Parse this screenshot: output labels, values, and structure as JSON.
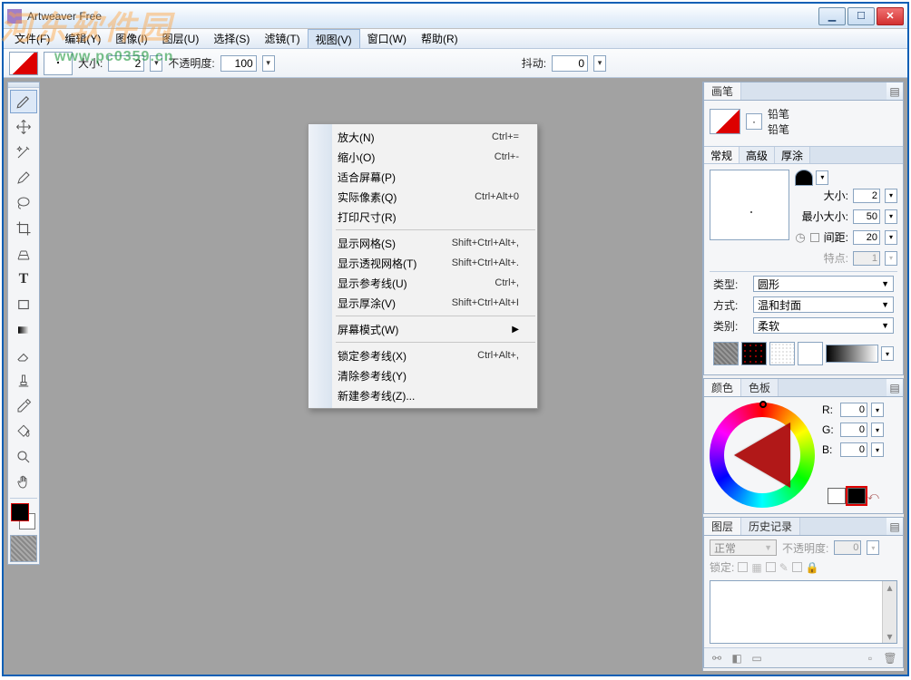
{
  "app": {
    "title": "Artweaver Free"
  },
  "watermark": {
    "text": "河东软件园",
    "url": "www.pc0359.cn"
  },
  "window_controls": {
    "min": "▁",
    "max": "☐",
    "close": "✕"
  },
  "menubar": [
    {
      "key": "file",
      "label": "文件(F)"
    },
    {
      "key": "edit",
      "label": "编辑(Y)"
    },
    {
      "key": "image",
      "label": "图像(I)"
    },
    {
      "key": "layer",
      "label": "图层(U)"
    },
    {
      "key": "select",
      "label": "选择(S)"
    },
    {
      "key": "filter",
      "label": "滤镜(T)"
    },
    {
      "key": "view",
      "label": "视图(V)",
      "open": true
    },
    {
      "key": "window",
      "label": "窗口(W)"
    },
    {
      "key": "help",
      "label": "帮助(R)"
    }
  ],
  "view_menu": [
    {
      "label": "放大(N)",
      "shortcut": "Ctrl+="
    },
    {
      "label": "缩小(O)",
      "shortcut": "Ctrl+-"
    },
    {
      "label": "适合屏幕(P)",
      "shortcut": ""
    },
    {
      "label": "实际像素(Q)",
      "shortcut": "Ctrl+Alt+0"
    },
    {
      "label": "打印尺寸(R)",
      "shortcut": ""
    },
    {
      "sep": true
    },
    {
      "label": "显示网格(S)",
      "shortcut": "Shift+Ctrl+Alt+,"
    },
    {
      "label": "显示透视网格(T)",
      "shortcut": "Shift+Ctrl+Alt+."
    },
    {
      "label": "显示参考线(U)",
      "shortcut": "Ctrl+,"
    },
    {
      "label": "显示厚涂(V)",
      "shortcut": "Shift+Ctrl+Alt+I"
    },
    {
      "sep": true
    },
    {
      "label": "屏幕模式(W)",
      "submenu": true
    },
    {
      "sep": true
    },
    {
      "label": "锁定参考线(X)",
      "shortcut": "Ctrl+Alt+,"
    },
    {
      "label": "清除参考线(Y)",
      "shortcut": ""
    },
    {
      "label": "新建参考线(Z)...",
      "shortcut": ""
    }
  ],
  "toolbar": {
    "size_label": "大小:",
    "size_value": "2",
    "opacity_label": "不透明度:",
    "opacity_value": "100",
    "jitter_label": "抖动:",
    "jitter_value": "0"
  },
  "tools": [
    "brush",
    "move",
    "wand",
    "pencil",
    "lasso",
    "crop",
    "perspective",
    "text",
    "shape",
    "gradient",
    "eraser",
    "stamp",
    "dropper",
    "paint-bucket",
    "zoom",
    "hand"
  ],
  "brush_panel": {
    "tab": "画笔",
    "name1": "铅笔",
    "name2": "铅笔",
    "subtabs": [
      "常规",
      "高级",
      "厚涂"
    ],
    "size_label": "大小:",
    "size_value": "2",
    "minsize_label": "最小大小:",
    "minsize_value": "50",
    "spacing_label": "间距:",
    "spacing_value": "20",
    "specials_label": "特点:",
    "specials_value": "1",
    "type_label": "类型:",
    "type_value": "圆形",
    "method_label": "方式:",
    "method_value": "温和封面",
    "category_label": "类别:",
    "category_value": "柔软"
  },
  "color_panel": {
    "tabs": [
      "颜色",
      "色板"
    ],
    "r_label": "R:",
    "r_value": "0",
    "g_label": "G:",
    "g_value": "0",
    "b_label": "B:",
    "b_value": "0"
  },
  "layer_panel": {
    "tabs": [
      "图层",
      "历史记录"
    ],
    "mode": "正常",
    "opacity_label": "不透明度:",
    "opacity_value": "0",
    "lock_label": "锁定:"
  }
}
